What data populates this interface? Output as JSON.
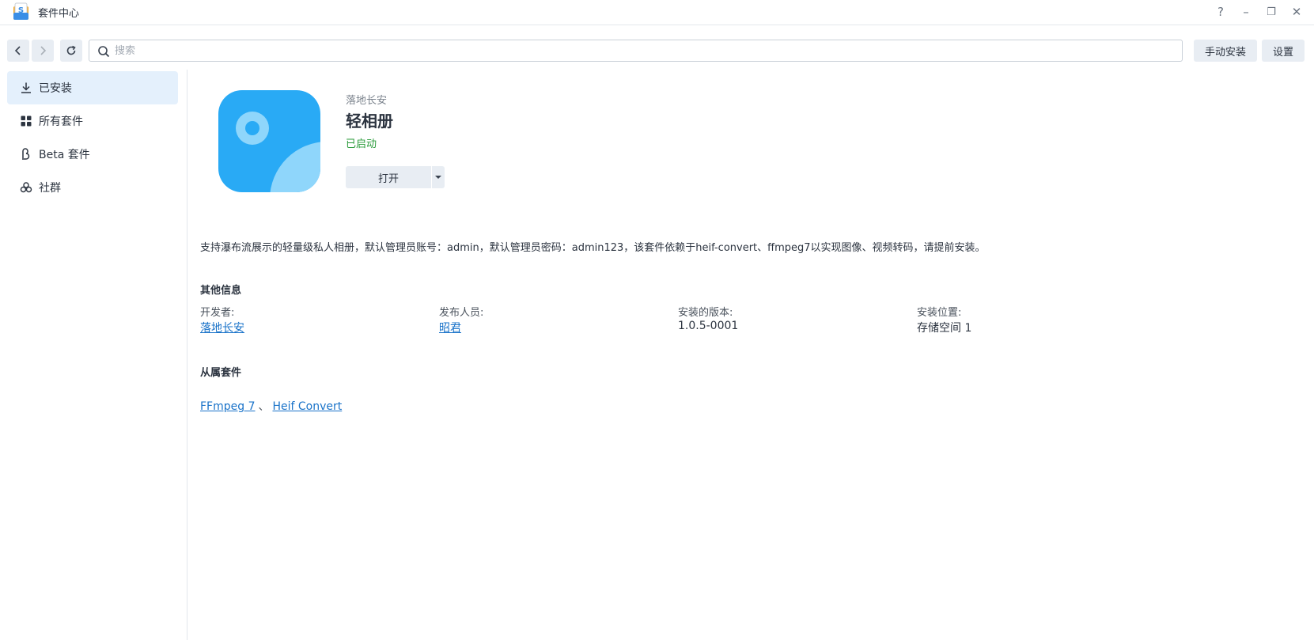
{
  "window": {
    "title": "套件中心",
    "controls": [
      "?",
      "–",
      "❐",
      "✕"
    ]
  },
  "toolbar": {
    "search_placeholder": "搜索",
    "manual_install_label": "手动安装",
    "settings_label": "设置"
  },
  "sidebar": {
    "items": [
      {
        "label": "已安装",
        "icon": "download-icon",
        "active": true
      },
      {
        "label": "所有套件",
        "icon": "grid-icon",
        "active": false
      },
      {
        "label": "Beta 套件",
        "icon": "beta-icon",
        "active": false
      },
      {
        "label": "社群",
        "icon": "community-icon",
        "active": false
      }
    ]
  },
  "package": {
    "developer": "落地长安",
    "name": "轻相册",
    "status": "已启动",
    "open_label": "打开",
    "description": "支持瀑布流展示的轻量级私人相册，默认管理员账号：admin，默认管理员密码：admin123，该套件依赖于heif-convert、ffmpeg7以实现图像、视频转码，请提前安装。",
    "icon_colors": {
      "background": "#29aaf5",
      "accent": "#8fd6fb"
    }
  },
  "other_info": {
    "title": "其他信息",
    "fields": [
      {
        "label": "开发者:",
        "value": "落地长安",
        "link": true
      },
      {
        "label": "发布人员:",
        "value": "昭君",
        "link": true
      },
      {
        "label": "安装的版本:",
        "value": "1.0.5-0001",
        "link": false
      },
      {
        "label": "安装位置:",
        "value": "存储空间 1",
        "link": false
      }
    ]
  },
  "dependencies": {
    "title": "从属套件",
    "separator": "、",
    "items": [
      "FFmpeg 7",
      "Heif Convert"
    ]
  }
}
